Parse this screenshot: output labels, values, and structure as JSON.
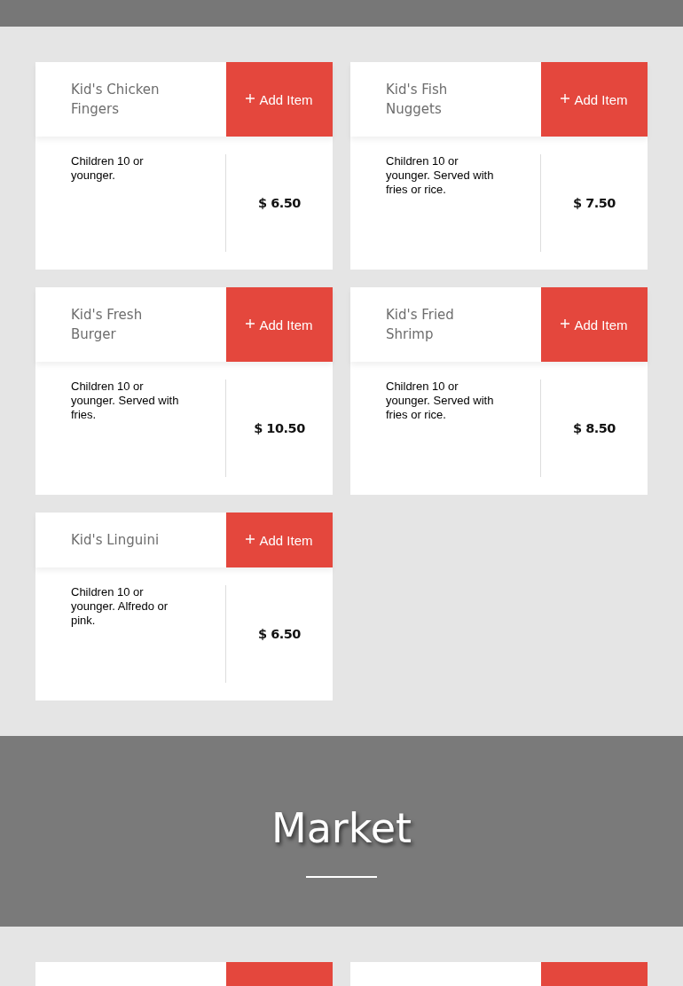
{
  "sections": [
    {
      "kind": "items",
      "items": [
        {
          "name": "Kid's Chicken Fingers",
          "button": "Add Item",
          "description": "Children 10 or younger.",
          "price": "$ 6.50"
        },
        {
          "name": "Kid's Fish Nuggets",
          "button": "Add Item",
          "description": "Children 10 or younger. Served with fries or rice.",
          "price": "$ 7.50"
        },
        {
          "name": "Kid's Fresh Burger",
          "button": "Add Item",
          "description": "Children 10 or younger. Served with fries.",
          "price": "$ 10.50"
        },
        {
          "name": "Kid's Fried Shrimp",
          "button": "Add Item",
          "description": "Children 10 or younger. Served with fries or rice.",
          "price": "$ 8.50"
        },
        {
          "name": "Kid's Linguini",
          "button": "Add Item",
          "description": "Children 10 or younger. Alfredo or pink.",
          "price": "$ 6.50"
        }
      ]
    },
    {
      "kind": "heading",
      "title": "Market"
    },
    {
      "kind": "cut"
    }
  ]
}
